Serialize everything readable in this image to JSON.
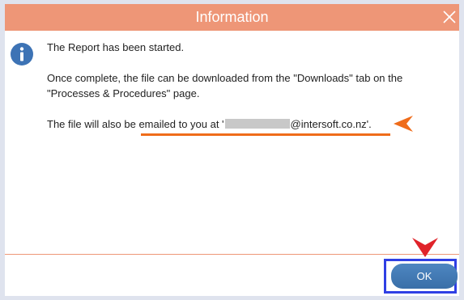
{
  "dialog": {
    "title": "Information",
    "close_icon": "close-icon",
    "info_icon": "info-icon",
    "ok_label": "OK",
    "colors": {
      "titlebar": "#ee9677",
      "accent_underline": "#ef6c1a",
      "highlight_box": "#2f3fe4",
      "red_arrow": "#e0232a",
      "button": "#3f7ab5"
    }
  },
  "message": {
    "line1": "The Report has been started.",
    "line2": "Once complete, the file can be downloaded from the \"Downloads\" tab on the",
    "line3": "\"Processes & Procedures\" page.",
    "line4_prefix": "The file will also be emailed to you at '",
    "line4_suffix": "@intersoft.co.nz'."
  }
}
